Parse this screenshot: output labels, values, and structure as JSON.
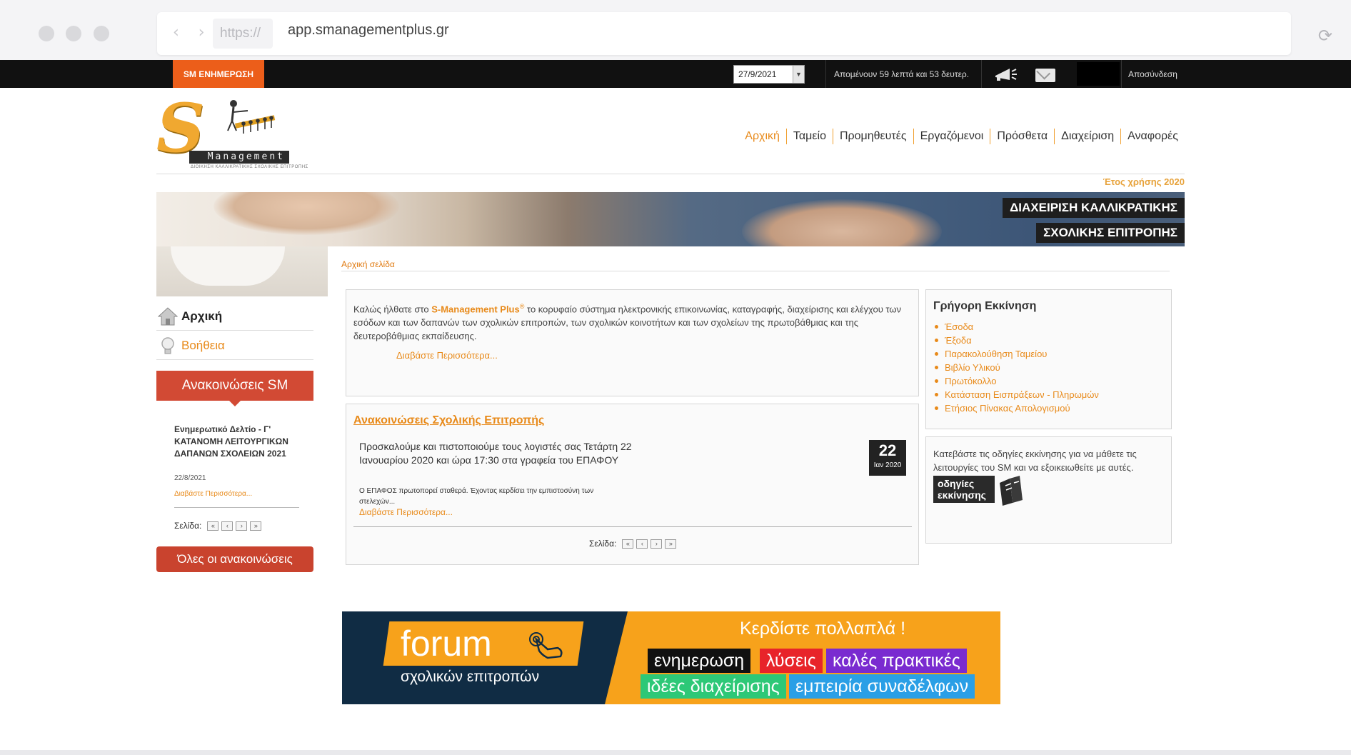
{
  "browser": {
    "protocol": "https://",
    "url": "app.smanagementplus.gr"
  },
  "topbar": {
    "sm_tab": "SM ΕΝΗΜΕΡΩΣΗ",
    "date_value": "27/9/2021",
    "remaining": "Απομένουν 59 λεπτά και 53 δευτερ.",
    "logout": "Αποσύνδεση"
  },
  "logo": {
    "text": "Management",
    "subtitle": "ΔΙΟΙΚΗΣΗ ΚΑΛΛΙΚΡΑΤΙΚΗΣ ΣΧΟΛΙΚΗΣ ΕΠΙΤΡΟΠΗΣ"
  },
  "nav": [
    "Αρχική",
    "Ταμείο",
    "Προμηθευτές",
    "Εργαζόμενοι",
    "Πρόσθετα",
    "Διαχείριση",
    "Αναφορές"
  ],
  "year_label": "Έτος χρήσης 2020",
  "banner": {
    "line1": "ΔΙΑΧΕΙΡΙΣΗ ΚΑΛΛΙΚΡΑΤΙΚΗΣ",
    "line2": "ΣΧΟΛΙΚΗΣ ΕΠΙΤΡΟΠΗΣ"
  },
  "breadcrumb": "Αρχική σελίδα",
  "sidebar": {
    "home": "Αρχική",
    "help": "Βοήθεια",
    "announcements_title": "Ανακοινώσεις SM",
    "item": {
      "title": "Ενημερωτικό Δελτίο - Γ' ΚΑΤΑΝΟΜΗ ΛΕΙΤΟΥΡΓΙΚΩΝ ΔΑΠΑΝΩΝ ΣΧΟΛΕΙΩΝ 2021",
      "date": "22/8/2021",
      "more": "Διαβάστε Περισσότερα..."
    },
    "page_label": "Σελίδα:",
    "all_button": "Όλες οι ανακοινώσεις"
  },
  "welcome": {
    "text_before": "Καλώς ήλθατε στο ",
    "brand": "S-Management Plus",
    "reg": "®",
    "text_after": " το κορυφαίο σύστημα ηλεκτρονικής επικοινωνίας, καταγραφής, διαχείρισης και ελέγχου των εσόδων και των δαπανών των σχολικών επιτροπών, των σχολικών κοινοτήτων και των σχολείων της πρωτοβάθμιας και της δευτεροβάθμιας εκπαίδευσης.",
    "more": "Διαβάστε Περισσότερα..."
  },
  "news": {
    "title": "Ανακοινώσεις Σχολικής Επιτροπής",
    "text": "Προσκαλούμε και πιστοποιούμε τους λογιστές σας Τετάρτη 22 Ιανουαρίου 2020 και ώρα 17:30 στα γραφεία του ΕΠΑΦΟΥ",
    "small": "Ο ΕΠΑΦΟΣ πρωτοπορεί σταθερά. Έχοντας κερδίσει την εμπιστοσύνη των στελεχών...",
    "more": "Διαβάστε Περισσότερα...",
    "day": "22",
    "month": "Ιαν 2020",
    "page_label": "Σελίδα:"
  },
  "quick_start": {
    "title": "Γρήγορη Εκκίνηση",
    "links": [
      "Έσοδα",
      "Έξοδα",
      "Παρακολούθηση Ταμείου",
      "Βιβλίο Υλικού",
      "Πρωτόκολλο",
      "Κατάσταση Εισπράξεων - Πληρωμών",
      "Ετήσιος Πίνακας Απολογισμού"
    ]
  },
  "guide": {
    "text": "Κατεβάστε τις οδηγίες εκκίνησης για να μάθετε τις λειτουργίες του SM και να εξοικειωθείτε με αυτές.",
    "badge": "οδηγίες εκκίνησης"
  },
  "forum_banner": {
    "word": "forum",
    "sub": "σχολικών επιτροπών",
    "headline": "Κερδίστε πολλαπλά !",
    "chips": [
      {
        "text": "ενημερωση",
        "color": "#111111"
      },
      {
        "text": "λύσεις",
        "color": "#e8242a"
      },
      {
        "text": "καλές πρακτικές",
        "color": "#7a2bd0"
      },
      {
        "text": "ιδέες διαχείρισης",
        "color": "#2dc877"
      },
      {
        "text": "εμπειρία συναδέλφων",
        "color": "#2a9fe6"
      }
    ]
  },
  "colors": {
    "accent_orange": "#e88a1a",
    "tab_orange": "#ec5e1a",
    "sidebar_red": "#d24a34",
    "forum_navy": "#102c44"
  }
}
